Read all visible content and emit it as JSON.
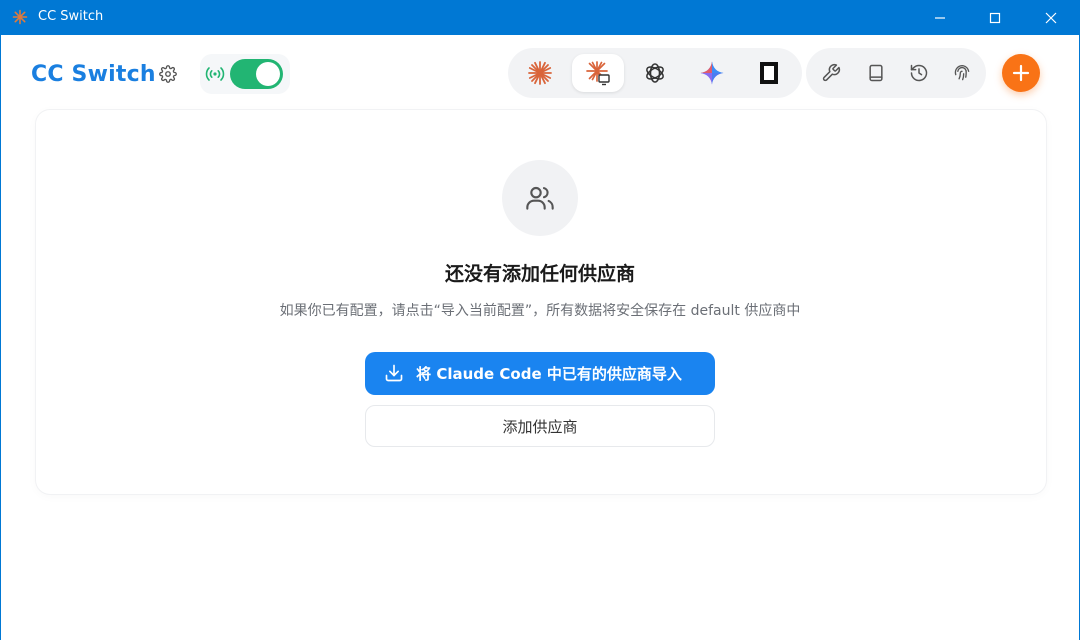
{
  "window": {
    "title": "CC Switch"
  },
  "header": {
    "brand": "CC Switch",
    "proxy_enabled": true,
    "accent_color": "#1a7fe0",
    "toggle_color": "#22b573",
    "apps": [
      {
        "id": "claude",
        "icon": "claude-starburst-icon",
        "active": false
      },
      {
        "id": "claude-desktop",
        "icon": "claude-desktop-icon",
        "active": true
      },
      {
        "id": "openai",
        "icon": "openai-icon",
        "active": false
      },
      {
        "id": "gemini",
        "icon": "gemini-icon",
        "active": false
      },
      {
        "id": "terminal",
        "icon": "terminal-app-icon",
        "active": false
      }
    ],
    "tools": [
      {
        "id": "tools",
        "icon": "wrench-icon"
      },
      {
        "id": "docs",
        "icon": "book-icon"
      },
      {
        "id": "history",
        "icon": "history-icon"
      },
      {
        "id": "fingerprint",
        "icon": "fingerprint-icon"
      }
    ],
    "add_button_color": "#f97316"
  },
  "empty_state": {
    "icon": "users-icon",
    "title": "还没有添加任何供应商",
    "description": "如果你已有配置，请点击“导入当前配置”，所有数据将安全保存在 default 供应商中",
    "import_button": "将 Claude Code 中已有的供应商导入",
    "add_button": "添加供应商"
  }
}
